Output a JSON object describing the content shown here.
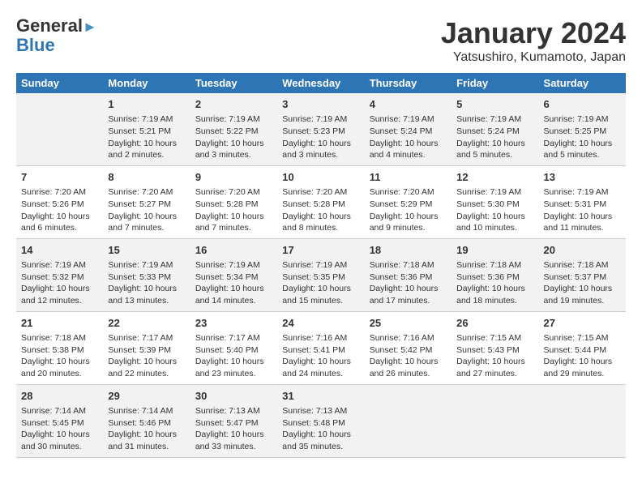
{
  "header": {
    "logo_line1": "General",
    "logo_line2": "Blue",
    "title": "January 2024",
    "subtitle": "Yatsushiro, Kumamoto, Japan"
  },
  "days_of_week": [
    "Sunday",
    "Monday",
    "Tuesday",
    "Wednesday",
    "Thursday",
    "Friday",
    "Saturday"
  ],
  "weeks": [
    [
      {
        "day": "",
        "info": ""
      },
      {
        "day": "1",
        "info": "Sunrise: 7:19 AM\nSunset: 5:21 PM\nDaylight: 10 hours\nand 2 minutes."
      },
      {
        "day": "2",
        "info": "Sunrise: 7:19 AM\nSunset: 5:22 PM\nDaylight: 10 hours\nand 3 minutes."
      },
      {
        "day": "3",
        "info": "Sunrise: 7:19 AM\nSunset: 5:23 PM\nDaylight: 10 hours\nand 3 minutes."
      },
      {
        "day": "4",
        "info": "Sunrise: 7:19 AM\nSunset: 5:24 PM\nDaylight: 10 hours\nand 4 minutes."
      },
      {
        "day": "5",
        "info": "Sunrise: 7:19 AM\nSunset: 5:24 PM\nDaylight: 10 hours\nand 5 minutes."
      },
      {
        "day": "6",
        "info": "Sunrise: 7:19 AM\nSunset: 5:25 PM\nDaylight: 10 hours\nand 5 minutes."
      }
    ],
    [
      {
        "day": "7",
        "info": "Sunrise: 7:20 AM\nSunset: 5:26 PM\nDaylight: 10 hours\nand 6 minutes."
      },
      {
        "day": "8",
        "info": "Sunrise: 7:20 AM\nSunset: 5:27 PM\nDaylight: 10 hours\nand 7 minutes."
      },
      {
        "day": "9",
        "info": "Sunrise: 7:20 AM\nSunset: 5:28 PM\nDaylight: 10 hours\nand 7 minutes."
      },
      {
        "day": "10",
        "info": "Sunrise: 7:20 AM\nSunset: 5:28 PM\nDaylight: 10 hours\nand 8 minutes."
      },
      {
        "day": "11",
        "info": "Sunrise: 7:20 AM\nSunset: 5:29 PM\nDaylight: 10 hours\nand 9 minutes."
      },
      {
        "day": "12",
        "info": "Sunrise: 7:19 AM\nSunset: 5:30 PM\nDaylight: 10 hours\nand 10 minutes."
      },
      {
        "day": "13",
        "info": "Sunrise: 7:19 AM\nSunset: 5:31 PM\nDaylight: 10 hours\nand 11 minutes."
      }
    ],
    [
      {
        "day": "14",
        "info": "Sunrise: 7:19 AM\nSunset: 5:32 PM\nDaylight: 10 hours\nand 12 minutes."
      },
      {
        "day": "15",
        "info": "Sunrise: 7:19 AM\nSunset: 5:33 PM\nDaylight: 10 hours\nand 13 minutes."
      },
      {
        "day": "16",
        "info": "Sunrise: 7:19 AM\nSunset: 5:34 PM\nDaylight: 10 hours\nand 14 minutes."
      },
      {
        "day": "17",
        "info": "Sunrise: 7:19 AM\nSunset: 5:35 PM\nDaylight: 10 hours\nand 15 minutes."
      },
      {
        "day": "18",
        "info": "Sunrise: 7:18 AM\nSunset: 5:36 PM\nDaylight: 10 hours\nand 17 minutes."
      },
      {
        "day": "19",
        "info": "Sunrise: 7:18 AM\nSunset: 5:36 PM\nDaylight: 10 hours\nand 18 minutes."
      },
      {
        "day": "20",
        "info": "Sunrise: 7:18 AM\nSunset: 5:37 PM\nDaylight: 10 hours\nand 19 minutes."
      }
    ],
    [
      {
        "day": "21",
        "info": "Sunrise: 7:18 AM\nSunset: 5:38 PM\nDaylight: 10 hours\nand 20 minutes."
      },
      {
        "day": "22",
        "info": "Sunrise: 7:17 AM\nSunset: 5:39 PM\nDaylight: 10 hours\nand 22 minutes."
      },
      {
        "day": "23",
        "info": "Sunrise: 7:17 AM\nSunset: 5:40 PM\nDaylight: 10 hours\nand 23 minutes."
      },
      {
        "day": "24",
        "info": "Sunrise: 7:16 AM\nSunset: 5:41 PM\nDaylight: 10 hours\nand 24 minutes."
      },
      {
        "day": "25",
        "info": "Sunrise: 7:16 AM\nSunset: 5:42 PM\nDaylight: 10 hours\nand 26 minutes."
      },
      {
        "day": "26",
        "info": "Sunrise: 7:15 AM\nSunset: 5:43 PM\nDaylight: 10 hours\nand 27 minutes."
      },
      {
        "day": "27",
        "info": "Sunrise: 7:15 AM\nSunset: 5:44 PM\nDaylight: 10 hours\nand 29 minutes."
      }
    ],
    [
      {
        "day": "28",
        "info": "Sunrise: 7:14 AM\nSunset: 5:45 PM\nDaylight: 10 hours\nand 30 minutes."
      },
      {
        "day": "29",
        "info": "Sunrise: 7:14 AM\nSunset: 5:46 PM\nDaylight: 10 hours\nand 31 minutes."
      },
      {
        "day": "30",
        "info": "Sunrise: 7:13 AM\nSunset: 5:47 PM\nDaylight: 10 hours\nand 33 minutes."
      },
      {
        "day": "31",
        "info": "Sunrise: 7:13 AM\nSunset: 5:48 PM\nDaylight: 10 hours\nand 35 minutes."
      },
      {
        "day": "",
        "info": ""
      },
      {
        "day": "",
        "info": ""
      },
      {
        "day": "",
        "info": ""
      }
    ]
  ]
}
